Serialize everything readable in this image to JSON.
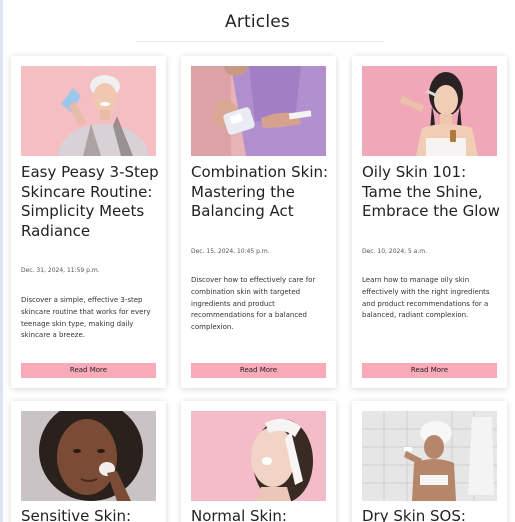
{
  "page": {
    "title": "Articles"
  },
  "articles": [
    {
      "title": "Easy Peasy 3-Step Skincare Routine: Simplicity Meets Radiance",
      "date": "Dec. 31, 2024, 11:59 p.m.",
      "description": "Discover a simple, effective 3-step skincare routine that works for every teenage skin type, making daily skincare a breeze.",
      "button": "Read More",
      "image": "woman-with-face-mask-photo"
    },
    {
      "title": "Combination Skin: Mastering the Balancing Act",
      "date": "Dec. 15, 2024, 10:45 p.m.",
      "description": "Discover how to effectively care for combination skin with targeted ingredients and product recommendations for a balanced complexion.",
      "button": "Read More",
      "image": "hands-with-toner-bottle-photo"
    },
    {
      "title": "Oily Skin 101: Tame the Shine, Embrace the Glow",
      "date": "Dec. 10, 2024, 5 a.m.",
      "description": "Learn how to manage oily skin effectively with the right ingredients and product recommendations for a balanced, radiant complexion.",
      "button": "Read More",
      "image": "woman-with-serum-dropper-photo"
    },
    {
      "title": "Sensitive Skin:",
      "image": "woman-with-cotton-pad-photo"
    },
    {
      "title": "Normal Skin:",
      "image": "woman-with-headband-photo"
    },
    {
      "title": "Dry Skin SOS:",
      "image": "woman-in-towel-bathroom-photo"
    }
  ],
  "colors": {
    "button_bg": "#f8aab8",
    "card_bg": "#ffffff",
    "title_text": "#222222"
  }
}
